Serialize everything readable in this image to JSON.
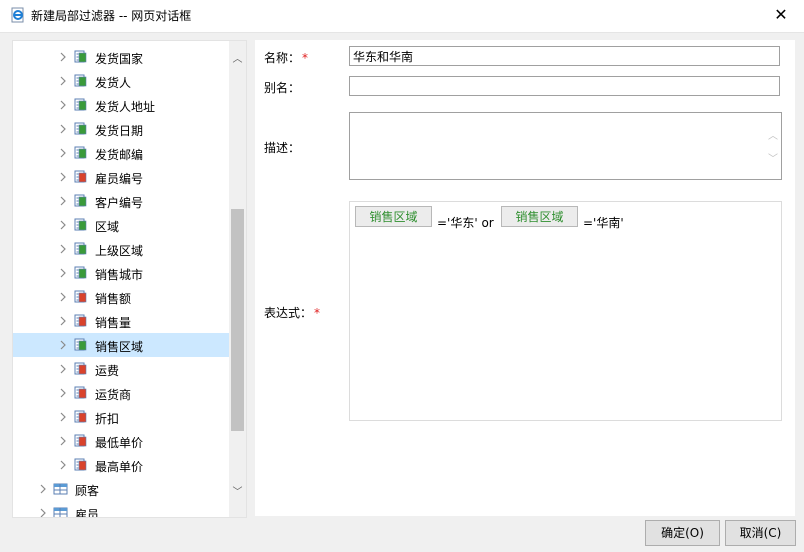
{
  "window": {
    "title": "新建局部过滤器 -- 网页对话框",
    "close_glyph": "✕"
  },
  "tree": {
    "items": [
      {
        "label": "发货国家",
        "icon": "field-icon-green",
        "level": 1
      },
      {
        "label": "发货人",
        "icon": "field-icon-green",
        "level": 1
      },
      {
        "label": "发货人地址",
        "icon": "field-icon-green",
        "level": 1
      },
      {
        "label": "发货日期",
        "icon": "field-icon-green",
        "level": 1
      },
      {
        "label": "发货邮编",
        "icon": "field-icon-green",
        "level": 1
      },
      {
        "label": "雇员编号",
        "icon": "field-icon-red",
        "level": 1
      },
      {
        "label": "客户编号",
        "icon": "field-icon-green",
        "level": 1
      },
      {
        "label": "区域",
        "icon": "field-icon-green",
        "level": 1
      },
      {
        "label": "上级区域",
        "icon": "field-icon-green",
        "level": 1
      },
      {
        "label": "销售城市",
        "icon": "field-icon-green",
        "level": 1
      },
      {
        "label": "销售额",
        "icon": "field-icon-red",
        "level": 1
      },
      {
        "label": "销售量",
        "icon": "field-icon-red",
        "level": 1
      },
      {
        "label": "销售区域",
        "icon": "field-icon-green",
        "level": 1,
        "selected": true
      },
      {
        "label": "运费",
        "icon": "field-icon-red",
        "level": 1
      },
      {
        "label": "运货商",
        "icon": "field-icon-red",
        "level": 1
      },
      {
        "label": "折扣",
        "icon": "field-icon-red",
        "level": 1
      },
      {
        "label": "最低单价",
        "icon": "field-icon-red",
        "level": 1
      },
      {
        "label": "最高单价",
        "icon": "field-icon-red",
        "level": 1
      },
      {
        "label": "顾客",
        "icon": "table-icon",
        "level": 0
      },
      {
        "label": "雇员",
        "icon": "table-icon",
        "level": 0
      }
    ]
  },
  "form": {
    "name_label": "名称：",
    "name_value": "华东和华南",
    "alias_label": "别名：",
    "alias_value": "",
    "desc_label": "描述：",
    "expr_label": "表达式：",
    "required_mark": "*",
    "expression": {
      "chip1": "销售区域",
      "text1": "='华东' or",
      "chip2": "销售区域",
      "text2": "='华南'"
    }
  },
  "buttons": {
    "ok": "确定(O)",
    "cancel": "取消(C)"
  },
  "colors": {
    "selected_row": "#cce8ff",
    "required": "#e02020",
    "chip_text": "#2f8f2f"
  }
}
